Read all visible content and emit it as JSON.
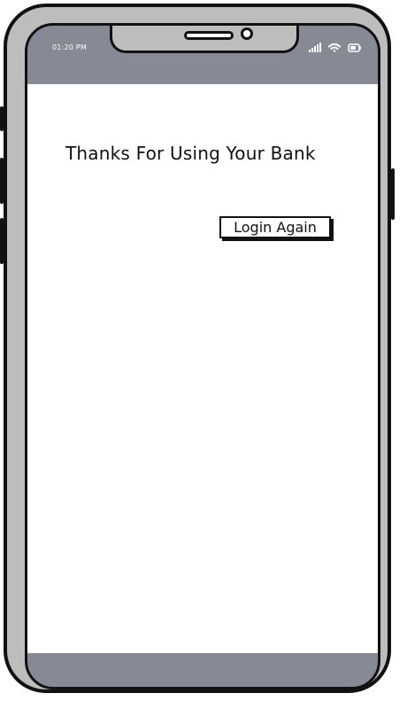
{
  "status_bar": {
    "time": "01:20 PM",
    "icons": [
      "signal-icon",
      "wifi-icon",
      "battery-icon"
    ]
  },
  "screen": {
    "message": "Thanks For Using Your Bank",
    "login_button_label": "Login Again"
  },
  "colors": {
    "frame": "#bdbdbd",
    "bezel": "#858a95",
    "outline": "#111111",
    "screen_background": "#ffffff"
  }
}
